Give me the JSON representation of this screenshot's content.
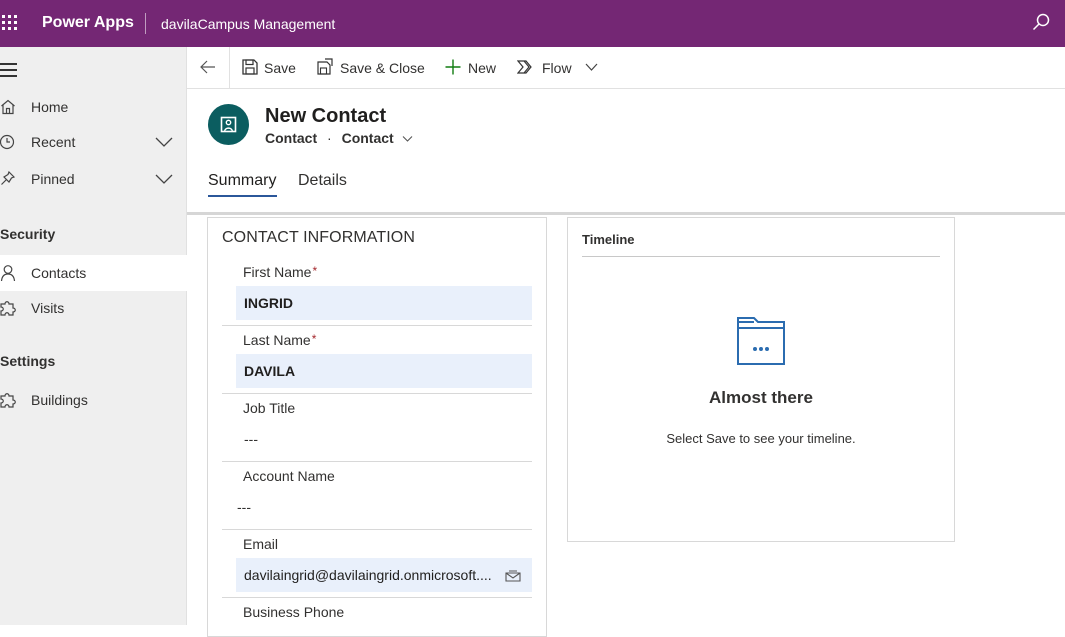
{
  "topbar": {
    "brand": "Power Apps",
    "app_name": "davilaCampus Management",
    "accent_color": "#742774"
  },
  "sidebar": {
    "items": [
      {
        "label": "Home",
        "icon": "home-icon"
      },
      {
        "label": "Recent",
        "icon": "clock-icon"
      },
      {
        "label": "Pinned",
        "icon": "pin-icon"
      }
    ],
    "groups": [
      {
        "label": "Security",
        "items": [
          {
            "label": "Contacts",
            "icon": "person-icon",
            "active": true
          },
          {
            "label": "Visits",
            "icon": "puzzle-icon"
          }
        ]
      },
      {
        "label": "Settings",
        "items": [
          {
            "label": "Buildings",
            "icon": "puzzle-icon"
          }
        ]
      }
    ]
  },
  "commandbar": {
    "save": "Save",
    "save_close": "Save & Close",
    "new": "New",
    "flow": "Flow"
  },
  "header": {
    "title": "New Contact",
    "entity": "Contact",
    "separator": "·",
    "form": "Contact"
  },
  "tabs": [
    {
      "label": "Summary",
      "active": true
    },
    {
      "label": "Details",
      "active": false
    }
  ],
  "contact_section": {
    "title": "CONTACT INFORMATION",
    "fields": [
      {
        "label": "First Name",
        "required": "*",
        "value": "INGRID"
      },
      {
        "label": "Last Name",
        "required": "*",
        "value": "DAVILA"
      },
      {
        "label": "Job Title",
        "value": "---"
      },
      {
        "label": "Account Name",
        "value": "---"
      },
      {
        "label": "Email",
        "value": "davilaingrid@davilaingrid.onmicrosoft...."
      },
      {
        "label": "Business Phone"
      }
    ]
  },
  "timeline": {
    "title": "Timeline",
    "heading": "Almost there",
    "message": "Select Save to see your timeline."
  }
}
